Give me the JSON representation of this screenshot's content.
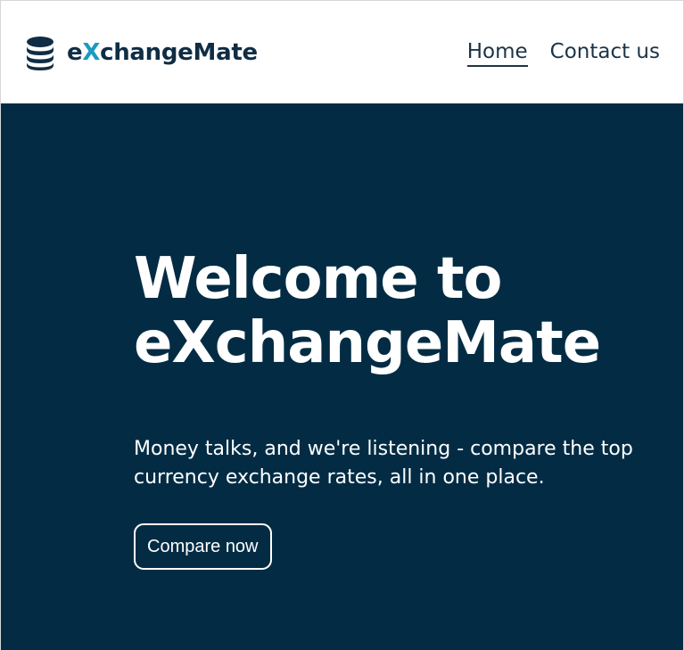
{
  "navbar": {
    "logo_icon": "coins-stack-icon",
    "brand_prefix": "e",
    "brand_accent": "X",
    "brand_suffix": "changeMate",
    "links": [
      {
        "label": "Home",
        "active": true
      },
      {
        "label": "Contact us",
        "active": false
      }
    ]
  },
  "hero": {
    "title_line1": "Welcome to",
    "title_line2": "eXchangeMate",
    "subtitle": "Money talks, and we're listening - compare the top currency exchange rates, all in one place.",
    "cta_label": "Compare now"
  },
  "colors": {
    "brand_dark": "#0f2d44",
    "brand_accent": "#1a9bbf",
    "hero_background": "#032c44",
    "text_light": "#ffffff"
  }
}
